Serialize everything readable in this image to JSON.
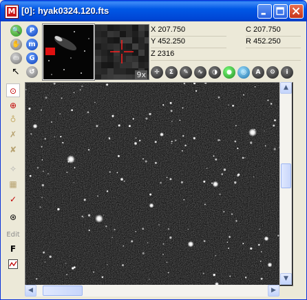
{
  "window": {
    "title": "[0]: hyak0324.120.fts",
    "app_icon_letter": "M",
    "controls": [
      "minimize",
      "maximize",
      "close"
    ]
  },
  "toolbar": {
    "left_buttons": [
      {
        "name": "zoom-icon",
        "glyph": "🔍"
      },
      {
        "name": "p-icon",
        "glyph": "P"
      },
      {
        "name": "hand-icon",
        "glyph": "✋"
      },
      {
        "name": "m-icon",
        "glyph": "m"
      },
      {
        "name": "window-icon",
        "glyph": "▭"
      },
      {
        "name": "g-icon",
        "glyph": "G"
      },
      {
        "name": "pointer-icon",
        "glyph": "↖"
      },
      {
        "name": "undo-icon",
        "glyph": "↺"
      }
    ],
    "zoom_label": "9x"
  },
  "readout": {
    "x": "X 207.750",
    "y": "Y 452.250",
    "z": "Z 2316",
    "c": "C 207.750",
    "r": "R 452.250"
  },
  "icon_row": [
    "crosshair-icon",
    "sigma-icon",
    "dropper-icon",
    "wave-icon",
    "contrast-icon",
    "palette-icon",
    "target-icon",
    "a-icon",
    "gear-icon",
    "info-icon"
  ],
  "icon_glyphs": [
    "✛",
    "Σ",
    "✎",
    "∿",
    "◑",
    "●",
    "◎",
    "A",
    "⚙",
    "i"
  ],
  "left_toolbar": {
    "edit_label": "Edit",
    "f_label": "F"
  },
  "colors": {
    "titlebar": "#0058e6",
    "window_bg": "#ece9d8",
    "image_bg": "#000000",
    "crosshair": "#ff2020"
  }
}
